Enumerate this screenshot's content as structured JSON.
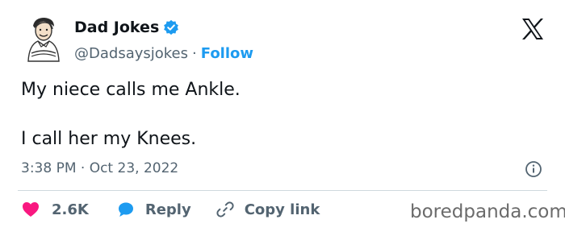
{
  "author": {
    "display_name": "Dad Jokes",
    "handle": "@Dadsaysjokes",
    "separator": "·",
    "follow_label": "Follow",
    "verified": true
  },
  "tweet": {
    "line1": "My niece calls me Ankle.",
    "line2": "I call her my Knees.",
    "time": "3:38 PM · Oct 23, 2022"
  },
  "actions": {
    "likes": "2.6K",
    "reply_label": "Reply",
    "copy_link_label": "Copy link"
  },
  "watermark": "boredpanda.com",
  "colors": {
    "brand_blue": "#1d9bf0",
    "like_pink": "#f91880",
    "text_dark": "#0f1419",
    "text_gray": "#536471"
  },
  "icons": [
    "avatar",
    "verified-badge-icon",
    "x-logo-icon",
    "info-icon",
    "heart-icon",
    "reply-bubble-icon",
    "link-icon"
  ]
}
